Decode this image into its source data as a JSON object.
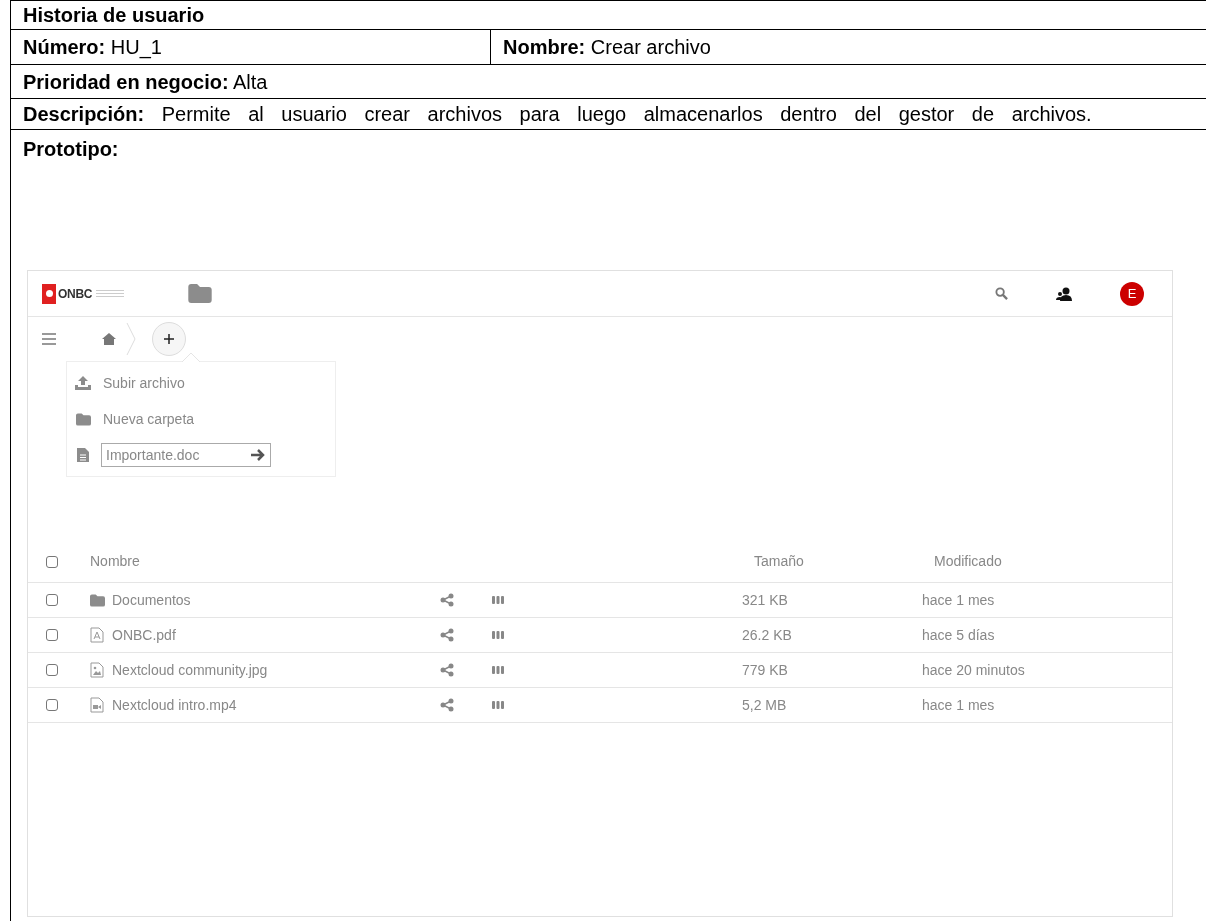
{
  "document": {
    "title": "Historia de usuario",
    "number": "**Número:** HU_1",
    "name": "**Nombre:** Crear archivo",
    "priority": "**Prioridad en negocio:**  Alta",
    "description": "**Descripción:** Permite al usuario crear archivos para luego almacenarlos dentro del gestor de archivos.",
    "prototype_label": "Prototipo:"
  },
  "app": {
    "logo": "ONBC",
    "avatar": "E",
    "new_menu": {
      "items": [
        {
          "kind": "upload",
          "label": "Subir archivo"
        },
        {
          "kind": "folder",
          "label": "Nueva carpeta"
        }
      ],
      "file_name_field": {
        "value": "Importante.doc"
      }
    },
    "table": {
      "header_checked": false,
      "columns": [
        "Nombre",
        "Tamaño",
        "Modificado"
      ],
      "rows": [
        {
          "kind": "folder",
          "name": "Documentos",
          "size": "321 KB",
          "modified": "hace 1 mes",
          "checked": false
        },
        {
          "kind": "pdf",
          "name": "ONBC.pdf",
          "size": "26.2 KB",
          "modified": "hace 5 días",
          "checked": false
        },
        {
          "kind": "image",
          "name": "Nextcloud community.jpg",
          "size": "779 KB",
          "modified": "hace 20 minutos",
          "checked": false
        },
        {
          "kind": "video",
          "name": "Nextcloud intro.mp4",
          "size": "5,2 MB",
          "modified": "hace 1 mes",
          "checked": false
        }
      ]
    }
  }
}
